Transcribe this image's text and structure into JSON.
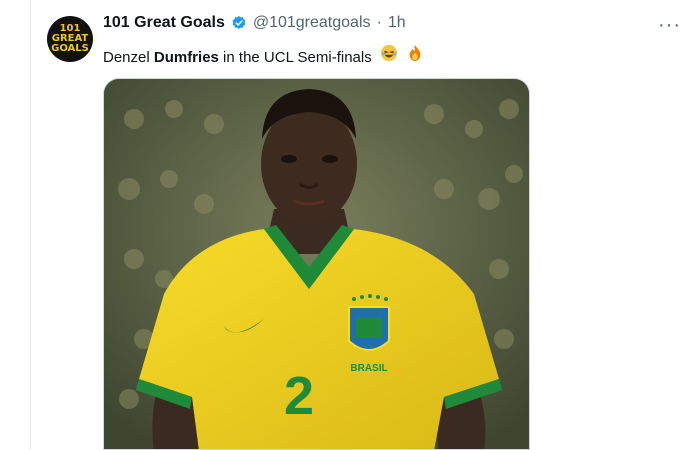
{
  "tweet": {
    "avatar_text": "101 GREAT GOALS",
    "display_name": "101 Great Goals",
    "verified_color": "#1d9bf0",
    "handle": "@101greatgoals",
    "separator": "·",
    "time": "1h",
    "more_icon": "more-horizontal-icon",
    "text_prefix": "Denzel ",
    "text_bold": "Dumfries",
    "text_suffix": " in the UCL Semi-finals",
    "emojis": [
      "laughing-face",
      "fire"
    ]
  },
  "image": {
    "shirt_number": "2",
    "crest_text": "BRASIL",
    "colors": {
      "shirt": "#f2d01c",
      "trim": "#1f8a3a",
      "background": "#5a6347",
      "skin": "#3b2a20"
    }
  }
}
